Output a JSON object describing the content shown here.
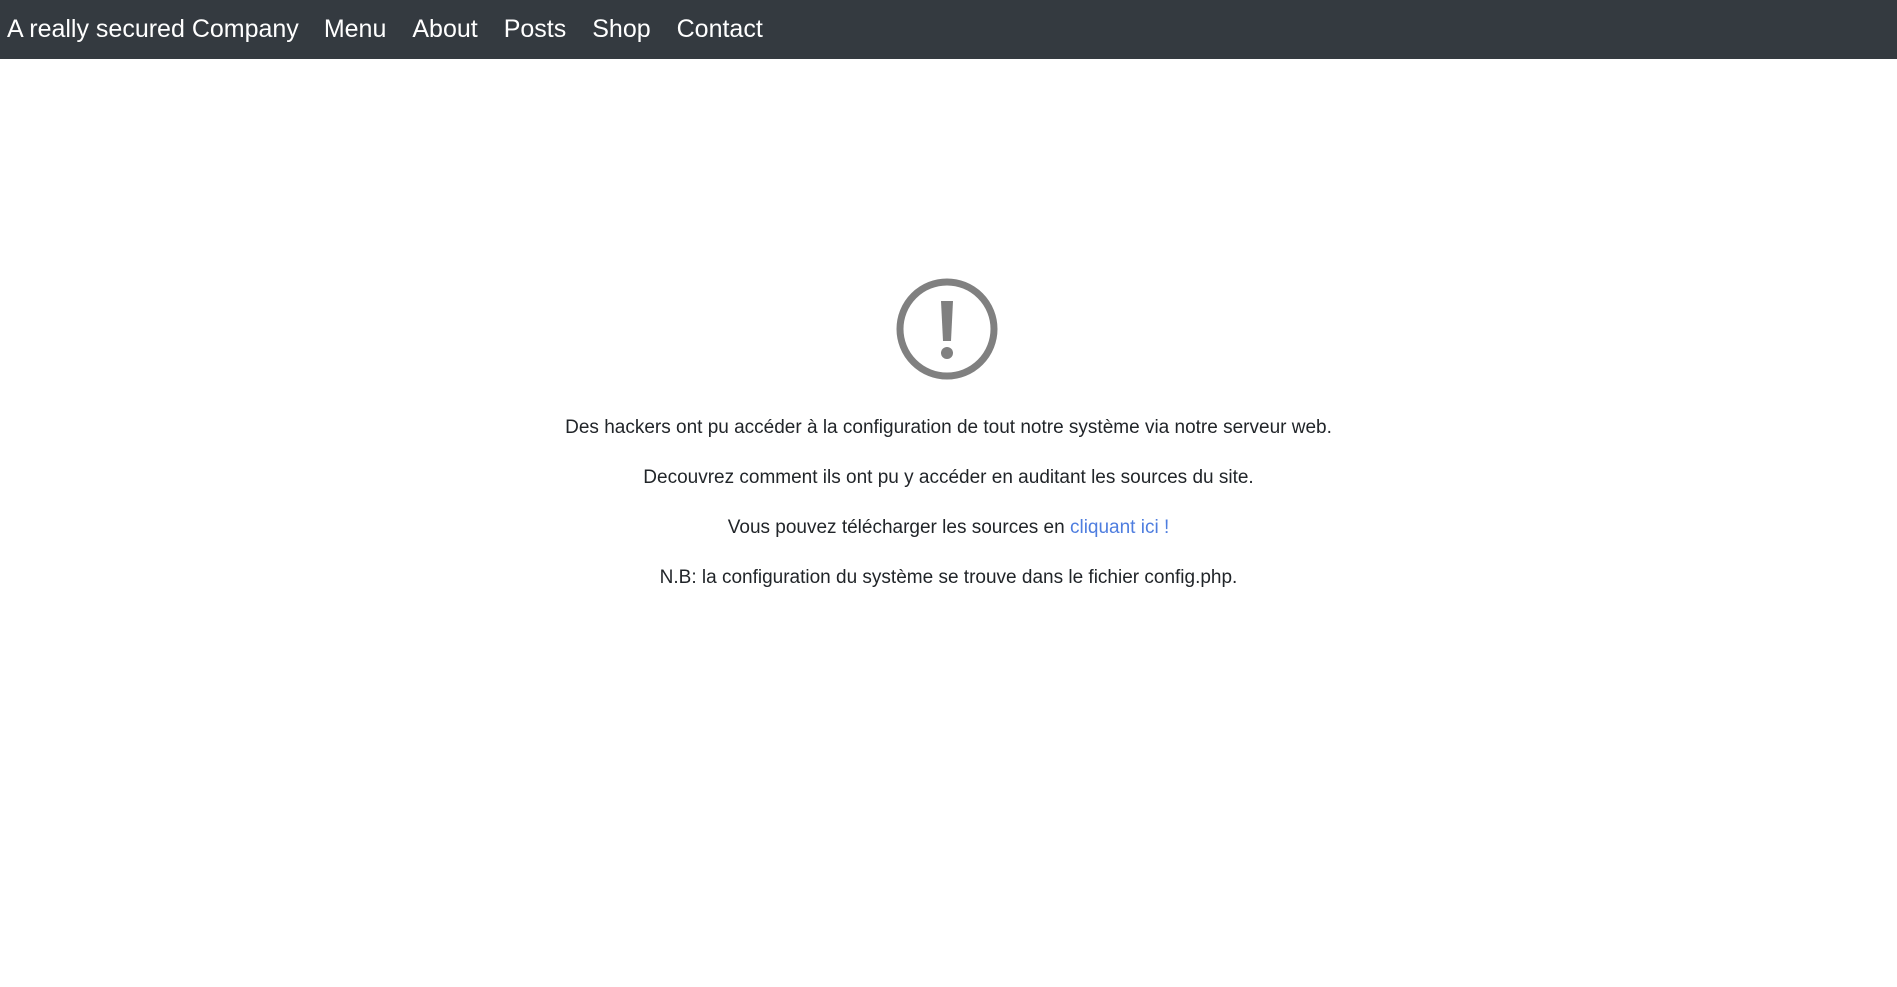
{
  "navbar": {
    "brand": "A really secured Company",
    "links": [
      "Menu",
      "About",
      "Posts",
      "Shop",
      "Contact"
    ]
  },
  "icon": {
    "name": "exclamation-circle-icon",
    "color": "#808080"
  },
  "content": {
    "line1": "Des hackers ont pu accéder à la configuration de tout notre système via notre serveur web.",
    "line2": "Decouvrez comment ils ont pu y accéder en auditant les sources du site.",
    "line3_prefix": "Vous pouvez télécharger les sources en ",
    "line3_link": "cliquant ici !",
    "line4": "N.B: la configuration du système se trouve dans le fichier config.php."
  },
  "colors": {
    "navbar_bg": "#343a40",
    "link": "#4e7ddf",
    "text": "#212529"
  }
}
